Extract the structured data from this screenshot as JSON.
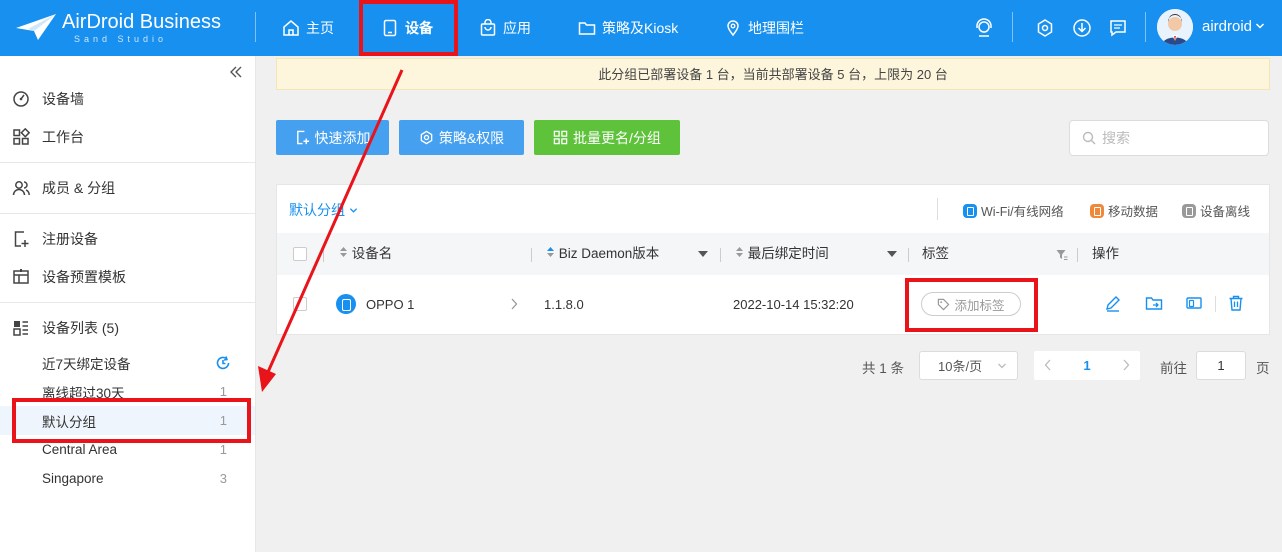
{
  "brand": {
    "name": "AirDroid Business",
    "sub": "Sand Studio"
  },
  "nav": [
    {
      "label": "主页"
    },
    {
      "label": "设备"
    },
    {
      "label": "应用"
    },
    {
      "label": "策略及Kiosk"
    },
    {
      "label": "地理围栏"
    }
  ],
  "user": {
    "name": "airdroid"
  },
  "sidebar": {
    "items": [
      {
        "label": "设备墙"
      },
      {
        "label": "工作台"
      },
      {
        "label": "成员 & 分组"
      },
      {
        "label": "注册设备"
      },
      {
        "label": "设备预置模板"
      },
      {
        "label": "设备列表 (5)"
      }
    ],
    "groups": [
      {
        "label": "近7天绑定设备",
        "count": ""
      },
      {
        "label": "离线超过30天",
        "count": "1"
      },
      {
        "label": "默认分组",
        "count": "1"
      },
      {
        "label": "Central Area",
        "count": "1"
      },
      {
        "label": "Singapore",
        "count": "3"
      }
    ]
  },
  "notice": "此分组已部署设备 1 台，当前共部署设备 5 台，上限为 20 台",
  "toolbar": {
    "quick_add": "快速添加",
    "policy": "策略&权限",
    "rename": "批量更名/分组",
    "search_placeholder": "搜索"
  },
  "panel": {
    "group": "默认分组",
    "legend": [
      "Wi-Fi/有线网络",
      "移动数据",
      "设备离线"
    ],
    "columns": [
      "设备名",
      "Biz Daemon版本",
      "最后绑定时间",
      "标签",
      "操作"
    ],
    "rows": [
      {
        "name": "OPPO 1",
        "version": "1.1.8.0",
        "time": "2022-10-14 15:32:20",
        "tag_btn": "添加标签"
      }
    ]
  },
  "pager": {
    "total": "共 1 条",
    "size": "10条/页",
    "page": "1",
    "goto": "前往",
    "goto_value": "1",
    "suffix": "页"
  },
  "colors": {
    "primary": "#1890f0",
    "green": "#52c41a",
    "highlight": "#e8141a",
    "orange": "#f0883a",
    "gray": "#999999"
  }
}
